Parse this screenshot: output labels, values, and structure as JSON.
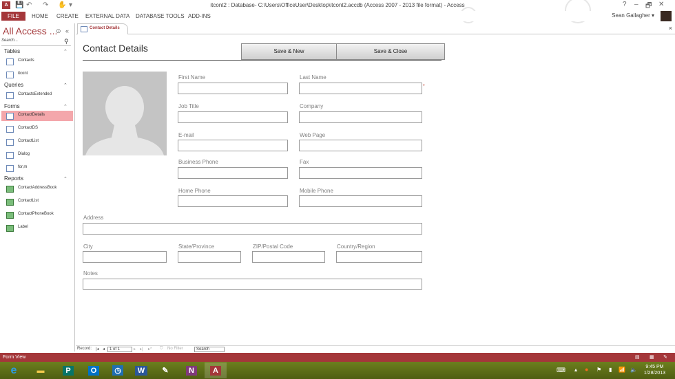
{
  "window": {
    "title": "itcont2 : Database- C:\\Users\\OfficeUser\\Desktop\\itcont2.accdb (Access 2007 - 2013 file format) - Access",
    "app_icon_text": "A",
    "controls": [
      "?",
      "–",
      "🗗",
      "✕"
    ]
  },
  "quick_access": [
    "💾",
    "↶",
    "↷",
    "✋",
    "▾"
  ],
  "ribbon": {
    "tabs": [
      "FILE",
      "HOME",
      "CREATE",
      "EXTERNAL DATA",
      "DATABASE TOOLS",
      "ADD-INS"
    ],
    "user": "Sean Gallagher ▾",
    "accent": "#a4373a"
  },
  "nav": {
    "title": "All Access ...",
    "search_placeholder": "Search...",
    "groups": [
      {
        "label": "Tables",
        "items": [
          {
            "label": "Contacts",
            "icon": "table-icon"
          },
          {
            "label": "itcont",
            "icon": "linked-table-icon"
          }
        ]
      },
      {
        "label": "Queries",
        "items": [
          {
            "label": "ContactsExtended",
            "icon": "query-icon"
          }
        ]
      },
      {
        "label": "Forms",
        "items": [
          {
            "label": "ContactDetails",
            "icon": "form-icon",
            "selected": true
          },
          {
            "label": "ContactDS",
            "icon": "form-icon"
          },
          {
            "label": "ContactList",
            "icon": "form-icon"
          },
          {
            "label": "Dialog",
            "icon": "form-icon"
          },
          {
            "label": "for,m",
            "icon": "form-icon"
          }
        ]
      },
      {
        "label": "Reports",
        "items": [
          {
            "label": "ContactAddressBook",
            "icon": "report-icon"
          },
          {
            "label": "ContactList",
            "icon": "report-icon"
          },
          {
            "label": "ContactPhoneBook",
            "icon": "report-icon"
          },
          {
            "label": "Label",
            "icon": "report-icon"
          }
        ]
      }
    ]
  },
  "doc_tab": {
    "label": "Contact Details",
    "close": "×"
  },
  "form": {
    "title": "Contact Details",
    "buttons": {
      "save_new": "Save & New",
      "save_close": "Save & Close"
    },
    "fields": {
      "first_name": {
        "label": "First Name",
        "value": ""
      },
      "last_name": {
        "label": "Last Name",
        "value": ""
      },
      "job_title": {
        "label": "Job Title",
        "value": ""
      },
      "company": {
        "label": "Company",
        "value": ""
      },
      "email": {
        "label": "E-mail",
        "value": ""
      },
      "web_page": {
        "label": "Web Page",
        "value": ""
      },
      "business_phone": {
        "label": "Business Phone",
        "value": ""
      },
      "fax": {
        "label": "Fax",
        "value": ""
      },
      "home_phone": {
        "label": "Home Phone",
        "value": ""
      },
      "mobile_phone": {
        "label": "Mobile Phone",
        "value": ""
      },
      "address": {
        "label": "Address",
        "value": ""
      },
      "city": {
        "label": "City",
        "value": ""
      },
      "state": {
        "label": "State/Province",
        "value": ""
      },
      "zip": {
        "label": "ZIP/Postal Code",
        "value": ""
      },
      "country": {
        "label": "Country/Region",
        "value": ""
      },
      "notes": {
        "label": "Notes",
        "value": ""
      }
    },
    "required_marker": "*"
  },
  "record_nav": {
    "label": "Record:",
    "first": "|◂",
    "prev": "◂",
    "position": "1 of 1",
    "next": "▸",
    "last": "▸|",
    "new": "▸*",
    "filter": "No Filter",
    "search": "Search"
  },
  "status": {
    "text": "Form View",
    "view_icons": [
      "▤",
      "▦",
      "✎"
    ]
  },
  "taskbar": {
    "apps": [
      {
        "name": "ie-icon",
        "glyph": "e"
      },
      {
        "name": "explorer-icon",
        "glyph": "▬"
      },
      {
        "name": "publisher-icon",
        "glyph": "P"
      },
      {
        "name": "outlook-icon",
        "glyph": "O"
      },
      {
        "name": "lync-icon",
        "glyph": "◷"
      },
      {
        "name": "word-icon",
        "glyph": "W"
      },
      {
        "name": "paint-icon",
        "glyph": "✎"
      },
      {
        "name": "onenote-icon",
        "glyph": "N"
      },
      {
        "name": "access-icon",
        "glyph": "A"
      }
    ],
    "time": "9:45 PM",
    "date": "1/28/2013"
  }
}
